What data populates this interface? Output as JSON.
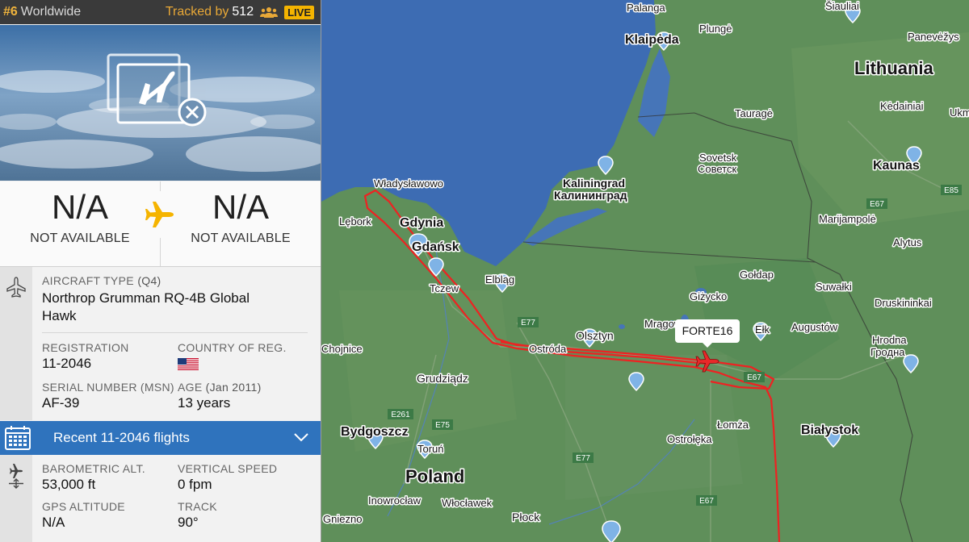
{
  "header": {
    "rank": "#6",
    "rank_scope": "Worldwide",
    "tracked_label": "Tracked by",
    "tracked_count": "512",
    "live_badge": "LIVE"
  },
  "route": {
    "origin_code": "N/A",
    "origin_name": "NOT AVAILABLE",
    "destination_code": "N/A",
    "destination_name": "NOT AVAILABLE"
  },
  "aircraft": {
    "type_label": "AIRCRAFT TYPE",
    "type_code": "(Q4)",
    "type_name": "Northrop Grumman RQ-4B Global Hawk",
    "registration_label": "REGISTRATION",
    "registration": "11-2046",
    "country_label": "COUNTRY OF REG.",
    "serial_label": "SERIAL NUMBER (MSN)",
    "serial": "AF-39",
    "age_label": "AGE",
    "age_detail": "(Jan 2011)",
    "age": "13 years"
  },
  "recent_flights": {
    "label": "Recent 11-2046 flights"
  },
  "telemetry": {
    "baro_label": "BAROMETRIC ALT.",
    "baro_value": "53,000 ft",
    "vspeed_label": "VERTICAL SPEED",
    "vspeed_value": "0 fpm",
    "gps_label": "GPS ALTITUDE",
    "gps_value": "N/A",
    "track_label": "TRACK",
    "track_value": "90°"
  },
  "map": {
    "callsign": "FORTE16",
    "labels": {
      "palanga": "Palanga",
      "plunge": "Plungė",
      "klaipeda": "Klaipėda",
      "panevezys": "Panevėžys",
      "siauliai": "Šiauliai",
      "lithuania": "Lithuania",
      "taurage": "Tauragė",
      "kedainiai": "Kėdainiai",
      "ukm": "Ukm",
      "sovetsk": "Sovetsk",
      "sovetsk_cyr": "Советск",
      "kaliningrad": "Kaliningrad",
      "kaliningrad_cyr": "Калининград",
      "kaunas": "Kaunas",
      "e85": "E85",
      "e67a": "E67",
      "marijampole": "Marijampolė",
      "wladyslawowo": "Władysławowo",
      "lebork": "Lębork",
      "gdynia": "Gdynia",
      "gdansk": "Gdańsk",
      "alytus": "Alytus",
      "goldap": "Gołdap",
      "tczew": "Tczew",
      "elblag": "Elbląg",
      "suwalki": "Suwałki",
      "druskininkai": "Druskininkai",
      "gizycko": "Giżycko",
      "mragowo": "Mrągowo",
      "e77a": "E77",
      "olsztyn": "Olsztyn",
      "elk": "Ełk",
      "augustow": "Augustów",
      "hrodna": "Hrodna",
      "hrodna_cyr": "Гродна",
      "chojnice": "Chojnice",
      "ostroda": "Ostróda",
      "e67b": "E67",
      "grudziadz": "Grudziądz",
      "e261": "E261",
      "e75": "E75",
      "lomza": "Łomża",
      "bydgoszcz": "Bydgoszcz",
      "bialystok": "Białystok",
      "torun": "Toruń",
      "ostroleka": "Ostrołęka",
      "e77b": "E77",
      "poland": "Poland",
      "inowroclaw": "Inowrocław",
      "wloclawek": "Włocławek",
      "e67c": "E67",
      "gniezno": "Gniezno",
      "plock": "Płock"
    }
  },
  "colors": {
    "land": "#5f8f5a",
    "sea": "#3d6cb3",
    "track": "#ee2222",
    "accent": "#2f73bd",
    "topbar": "#3a3a3a",
    "plane_yellow": "#f5b400"
  }
}
